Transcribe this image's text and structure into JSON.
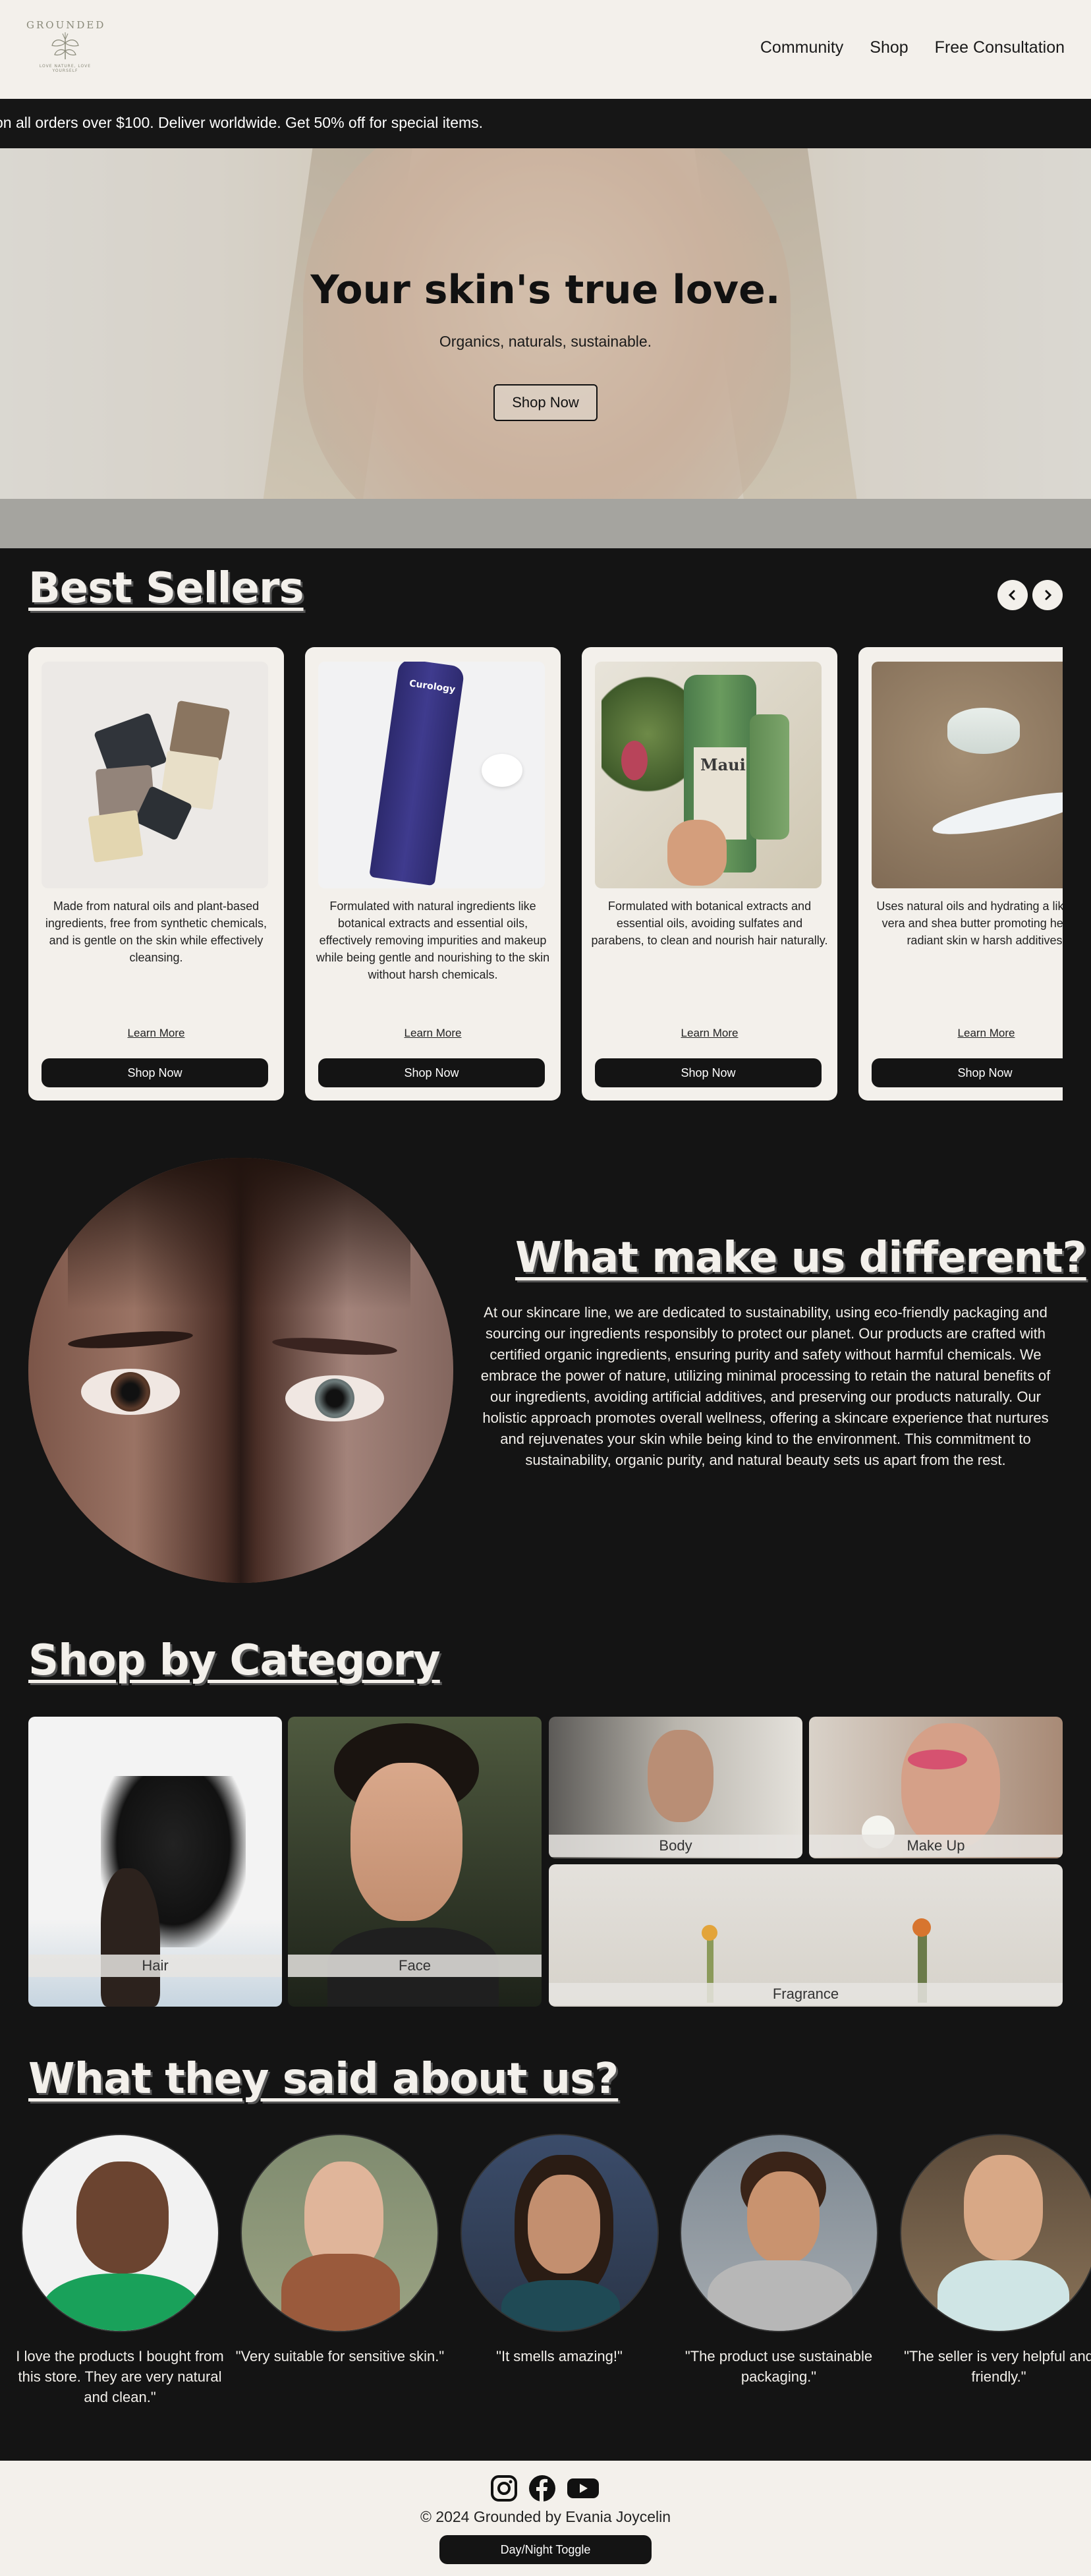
{
  "brand": {
    "logo_text": "GROUNDED",
    "logo_subtext": "LOVE NATURE, LOVE YOURSELF"
  },
  "nav": {
    "items": [
      "Community",
      "Shop",
      "Free Consultation"
    ]
  },
  "promo": {
    "text": "on all orders over $100. Deliver worldwide. Get 50% off for special items."
  },
  "hero": {
    "title": "Your skin's true love.",
    "subtitle": "Organics, naturals, sustainable.",
    "button": "Shop Now"
  },
  "best_sellers": {
    "title": "Best Sellers",
    "cards": [
      {
        "description": "Made from natural oils and plant-based ingredients, free from synthetic chemicals, and is gentle on the skin while effectively cleansing.",
        "learn_more": "Learn More",
        "button": "Shop Now"
      },
      {
        "description": "Formulated with natural ingredients like botanical extracts and essential oils, effectively removing impurities and makeup while being gentle and nourishing to the skin without harsh chemicals.",
        "learn_more": "Learn More",
        "button": "Shop Now",
        "product_text": "Curology"
      },
      {
        "description": "Formulated with botanical extracts and essential oils, avoiding sulfates and parabens, to clean and nourish hair naturally.",
        "learn_more": "Learn More",
        "button": "Shop Now",
        "product_text": "Maui"
      },
      {
        "description": "Uses natural oils and hydrating a like aloe vera and shea butter promoting healthy, radiant skin w harsh additives.",
        "learn_more": "Learn More",
        "button": "Shop Now"
      }
    ]
  },
  "different": {
    "title": "What make us different?",
    "body": "At our skincare line, we are dedicated to sustainability, using eco-friendly packaging and sourcing our ingredients responsibly to protect our planet. Our products are crafted with certified organic ingredients, ensuring purity and safety without harmful chemicals. We embrace the power of nature, utilizing minimal processing to retain the natural benefits of our ingredients, avoiding artificial additives, and preserving our products naturally. Our holistic approach promotes overall wellness, offering a skincare experience that nurtures and rejuvenates your skin while being kind to the environment. This commitment to sustainability, organic purity, and natural beauty sets us apart from the rest."
  },
  "category": {
    "title": "Shop by Category",
    "items": [
      "Hair",
      "Face",
      "Body",
      "Make Up",
      "Fragrance"
    ]
  },
  "testimonials": {
    "title": "What they said about us?",
    "quotes": [
      "I love the products I bought from this store. They are very natural and clean.\"",
      "\"Very suitable for sensitive skin.\"",
      "\"It smells amazing!\"",
      "\"The product use sustainable packaging.\"",
      "\"The seller is very helpful and friendly.\""
    ]
  },
  "footer": {
    "copyright": "© 2024 Grounded by Evania Joycelin",
    "toggle": "Day/Night Toggle",
    "social_icons": [
      "instagram-icon",
      "facebook-icon",
      "youtube-icon"
    ]
  },
  "colors": {
    "background": "#141414",
    "cream": "#f3f0eb",
    "button": "#141414"
  }
}
